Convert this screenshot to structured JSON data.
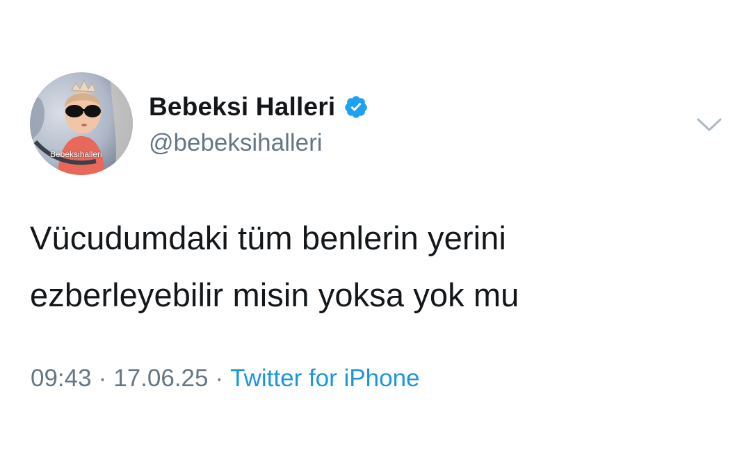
{
  "profile": {
    "display_name": "Bebeksi Halleri",
    "username": "@bebeksihalleri",
    "avatar_watermark": "Bebeksihalleri",
    "verified": true
  },
  "tweet": {
    "text_line1": "Vücudumdaki tüm benlerin yerini",
    "text_line2": "ezberleyebilir misin yoksa yok mu"
  },
  "meta": {
    "time": "09:43",
    "separator": "·",
    "date": "17.06.25",
    "source": "Twitter for iPhone"
  },
  "icons": {
    "verified": "verified-badge-icon",
    "caret": "chevron-down-icon"
  },
  "colors": {
    "text": "#14171a",
    "secondary": "#657786",
    "link": "#1b95e0",
    "verified": "#1da1f2"
  }
}
